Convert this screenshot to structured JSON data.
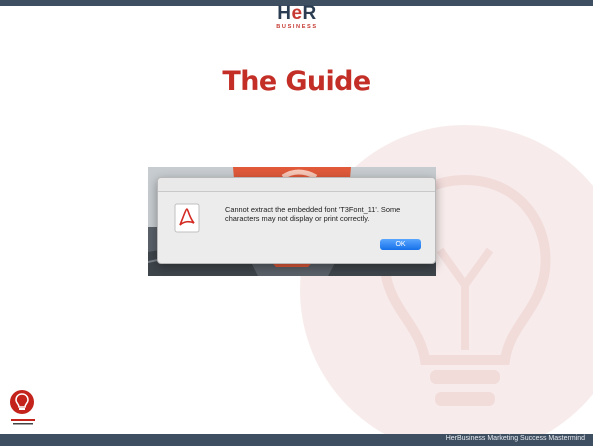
{
  "brand": {
    "mark_left": "H",
    "mark_accent": "e",
    "mark_right": "R",
    "sub": "BUSINESS"
  },
  "slide": {
    "title": "The Guide"
  },
  "dialog": {
    "message": "Cannot extract the embedded font 'T3Font_11'. Some characters may not display or print correctly.",
    "ok_label": "OK",
    "icon": "acrobat-icon"
  },
  "footer": {
    "text": "HerBusiness Marketing Success Mastermind"
  },
  "colors": {
    "accent": "#c32f27",
    "bar": "#3f4f62",
    "button": "#1671e8"
  }
}
